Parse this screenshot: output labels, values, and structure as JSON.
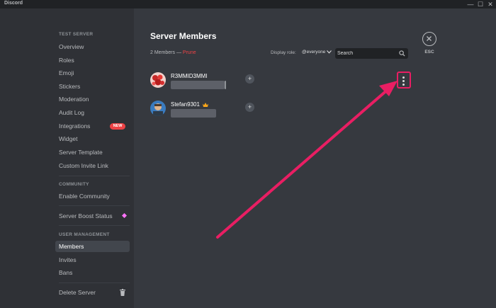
{
  "window": {
    "title": "Discord",
    "controls": [
      "—",
      "☐",
      "✕"
    ]
  },
  "sidebar": {
    "server_header": "TEST SERVER",
    "items": [
      "Overview",
      "Roles",
      "Emoji",
      "Stickers",
      "Moderation",
      "Audit Log",
      "Integrations",
      "Widget",
      "Server Template",
      "Custom Invite Link"
    ],
    "integrations_badge": "NEW",
    "community_header": "COMMUNITY",
    "community_items": [
      "Enable Community"
    ],
    "boost_item": "Server Boost Status",
    "user_mgmt_header": "USER MANAGEMENT",
    "user_mgmt_items": [
      "Members",
      "Invites",
      "Bans"
    ],
    "selected": "Members",
    "delete_item": "Delete Server"
  },
  "main": {
    "title": "Server Members",
    "member_count": "2 Members",
    "separator": "—",
    "prune": "Prune",
    "display_role_label": "Display role:",
    "display_role_value": "@everyone",
    "search_placeholder": "Search",
    "esc_label": "ESC",
    "members": [
      {
        "name": "R3MMID3MMI",
        "owner": false
      },
      {
        "name": "Stefan9301",
        "owner": true
      }
    ],
    "add_role_symbol": "+"
  },
  "colors": {
    "accent_highlight": "#e91e63",
    "danger": "#ed4245",
    "boost": "#ff73fa"
  }
}
